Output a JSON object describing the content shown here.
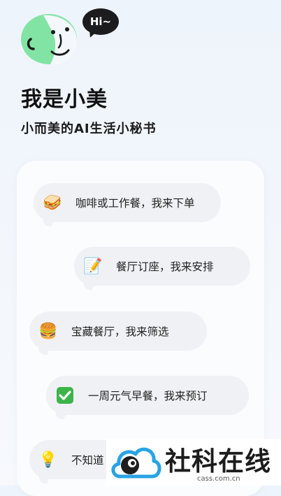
{
  "header": {
    "hi_text": "Hi~",
    "title": "我是小美",
    "subtitle": "小而美的AI生活小秘书"
  },
  "features": [
    {
      "icon": "sandwich-icon",
      "emoji": "🥪",
      "label": "咖啡或工作餐，我来下单"
    },
    {
      "icon": "memo-icon",
      "emoji": "📝",
      "label": "餐厅订座，我来安排"
    },
    {
      "icon": "burger-icon",
      "emoji": "🍔",
      "label": "宝藏餐厅，我来筛选"
    },
    {
      "icon": "check-icon",
      "emoji": "✅",
      "label": "一周元气早餐，我来预订"
    },
    {
      "icon": "bulb-icon",
      "emoji": "💡",
      "label": "不知道"
    }
  ],
  "watermark": {
    "name": "社科在线",
    "url": "cass.com.cn"
  },
  "colors": {
    "avatar_green": "#7fe3a0",
    "bubble_dark": "#1c1c1e",
    "pill_bg": "#eff1f5",
    "logo_blue": "#29a3e6"
  }
}
